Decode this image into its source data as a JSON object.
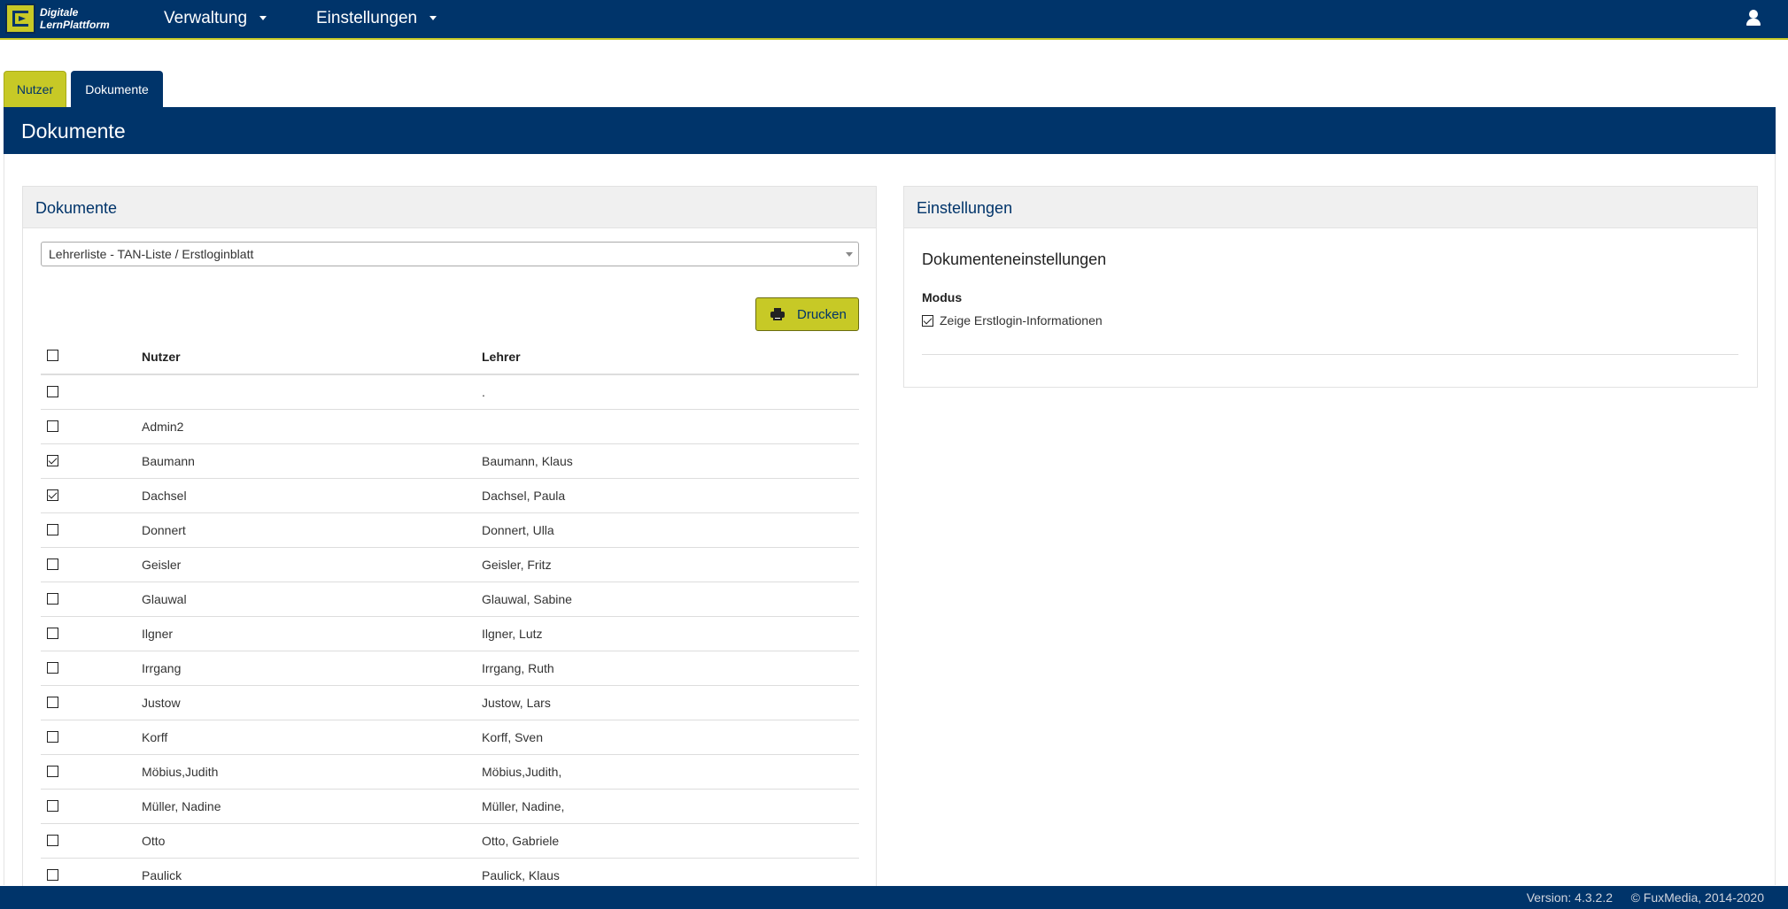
{
  "app": {
    "logo_line1": "Digitale",
    "logo_line2": "LernPlattform"
  },
  "nav": {
    "items": [
      {
        "label": "Verwaltung"
      },
      {
        "label": "Einstellungen"
      }
    ]
  },
  "tabs": [
    {
      "label": "Nutzer",
      "active": false
    },
    {
      "label": "Dokumente",
      "active": true
    }
  ],
  "page": {
    "title": "Dokumente"
  },
  "documents_panel": {
    "title": "Dokumente",
    "select_value": "Lehrerliste - TAN-Liste / Erstloginblatt",
    "print_label": "Drucken",
    "columns": {
      "nutzer": "Nutzer",
      "lehrer": "Lehrer"
    },
    "rows": [
      {
        "nutzer": "",
        "lehrer": ".",
        "checked": false
      },
      {
        "nutzer": "Admin2",
        "lehrer": "",
        "checked": false
      },
      {
        "nutzer": "Baumann",
        "lehrer": "Baumann, Klaus",
        "checked": true
      },
      {
        "nutzer": "Dachsel",
        "lehrer": "Dachsel, Paula",
        "checked": true
      },
      {
        "nutzer": "Donnert",
        "lehrer": "Donnert, Ulla",
        "checked": false
      },
      {
        "nutzer": "Geisler",
        "lehrer": "Geisler, Fritz",
        "checked": false
      },
      {
        "nutzer": "Glauwal",
        "lehrer": "Glauwal, Sabine",
        "checked": false
      },
      {
        "nutzer": "Ilgner",
        "lehrer": "Ilgner, Lutz",
        "checked": false
      },
      {
        "nutzer": "Irrgang",
        "lehrer": "Irrgang, Ruth",
        "checked": false
      },
      {
        "nutzer": "Justow",
        "lehrer": "Justow, Lars",
        "checked": false
      },
      {
        "nutzer": "Korff",
        "lehrer": "Korff, Sven",
        "checked": false
      },
      {
        "nutzer": "Möbius,Judith",
        "lehrer": "Möbius,Judith,",
        "checked": false
      },
      {
        "nutzer": "Müller, Nadine",
        "lehrer": "Müller, Nadine,",
        "checked": false
      },
      {
        "nutzer": "Otto",
        "lehrer": "Otto, Gabriele",
        "checked": false
      },
      {
        "nutzer": "Paulick",
        "lehrer": "Paulick, Klaus",
        "checked": false
      }
    ]
  },
  "settings_panel": {
    "title": "Einstellungen",
    "subtitle": "Dokumenteneinstellungen",
    "modus_label": "Modus",
    "option_label": "Zeige Erstlogin-Informationen",
    "option_checked": true
  },
  "footer": {
    "version": "Version: 4.3.2.2",
    "copyright": "© FuxMedia, 2014-2020"
  },
  "colors": {
    "primary": "#00346a",
    "accent": "#c7c926"
  }
}
